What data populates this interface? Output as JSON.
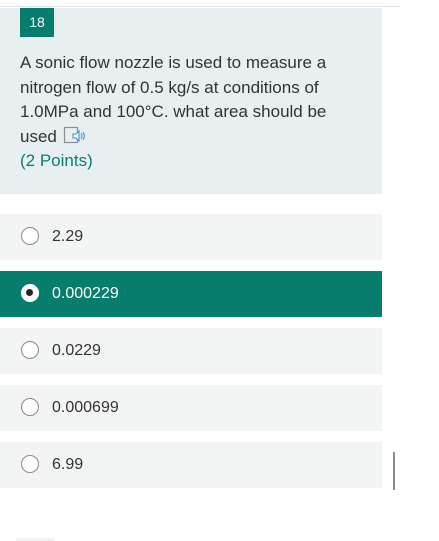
{
  "question": {
    "number": "18",
    "text": "A sonic flow nozzle is used to measure a nitrogen flow of 0.5 kg/s at conditions of 1.0MPa and 100°C. what area should be used",
    "points": "(2 Points)",
    "speaker_icon": "speaker-icon"
  },
  "options": [
    {
      "label": "2.29",
      "selected": false
    },
    {
      "label": "0.000229",
      "selected": true
    },
    {
      "label": "0.0229",
      "selected": false
    },
    {
      "label": "0.000699",
      "selected": false
    },
    {
      "label": "6.99",
      "selected": false
    }
  ],
  "colors": {
    "accent": "#077d6e",
    "card_background": "#e7eff1",
    "option_background": "#f3f4f4",
    "text": "#333333"
  }
}
